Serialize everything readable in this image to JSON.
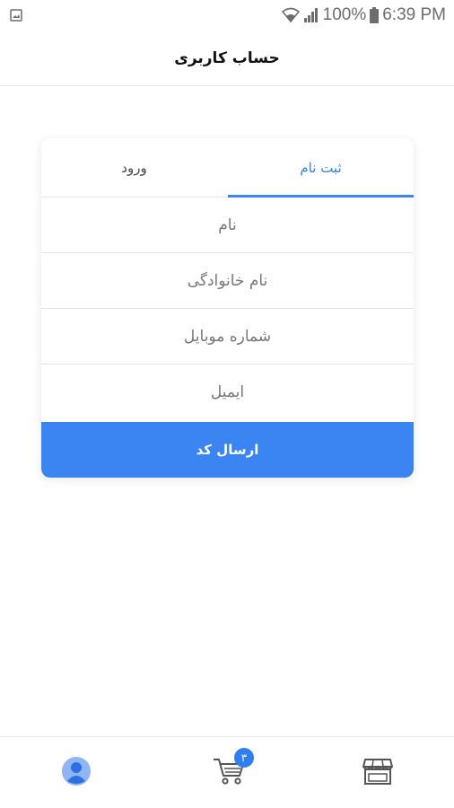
{
  "status_bar": {
    "battery_percent": "100%",
    "time": "6:39 PM",
    "icons": [
      "image-icon",
      "wifi-icon",
      "signal-icon",
      "battery-icon"
    ]
  },
  "header": {
    "title": "حساب کاربری"
  },
  "tabs": {
    "login_label": "ورود",
    "register_label": "ثبت نام",
    "active": "register"
  },
  "form": {
    "first_name_placeholder": "نام",
    "last_name_placeholder": "نام خانوادگی",
    "mobile_placeholder": "شماره موبایل",
    "email_placeholder": "ایمیل",
    "submit_label": "ارسال کد"
  },
  "bottom_nav": {
    "items": [
      "profile-icon",
      "cart-icon",
      "store-icon"
    ],
    "cart_badge": "۳"
  },
  "colors": {
    "accent": "#3b85f2",
    "active_tab_text": "#2f7ff0"
  }
}
